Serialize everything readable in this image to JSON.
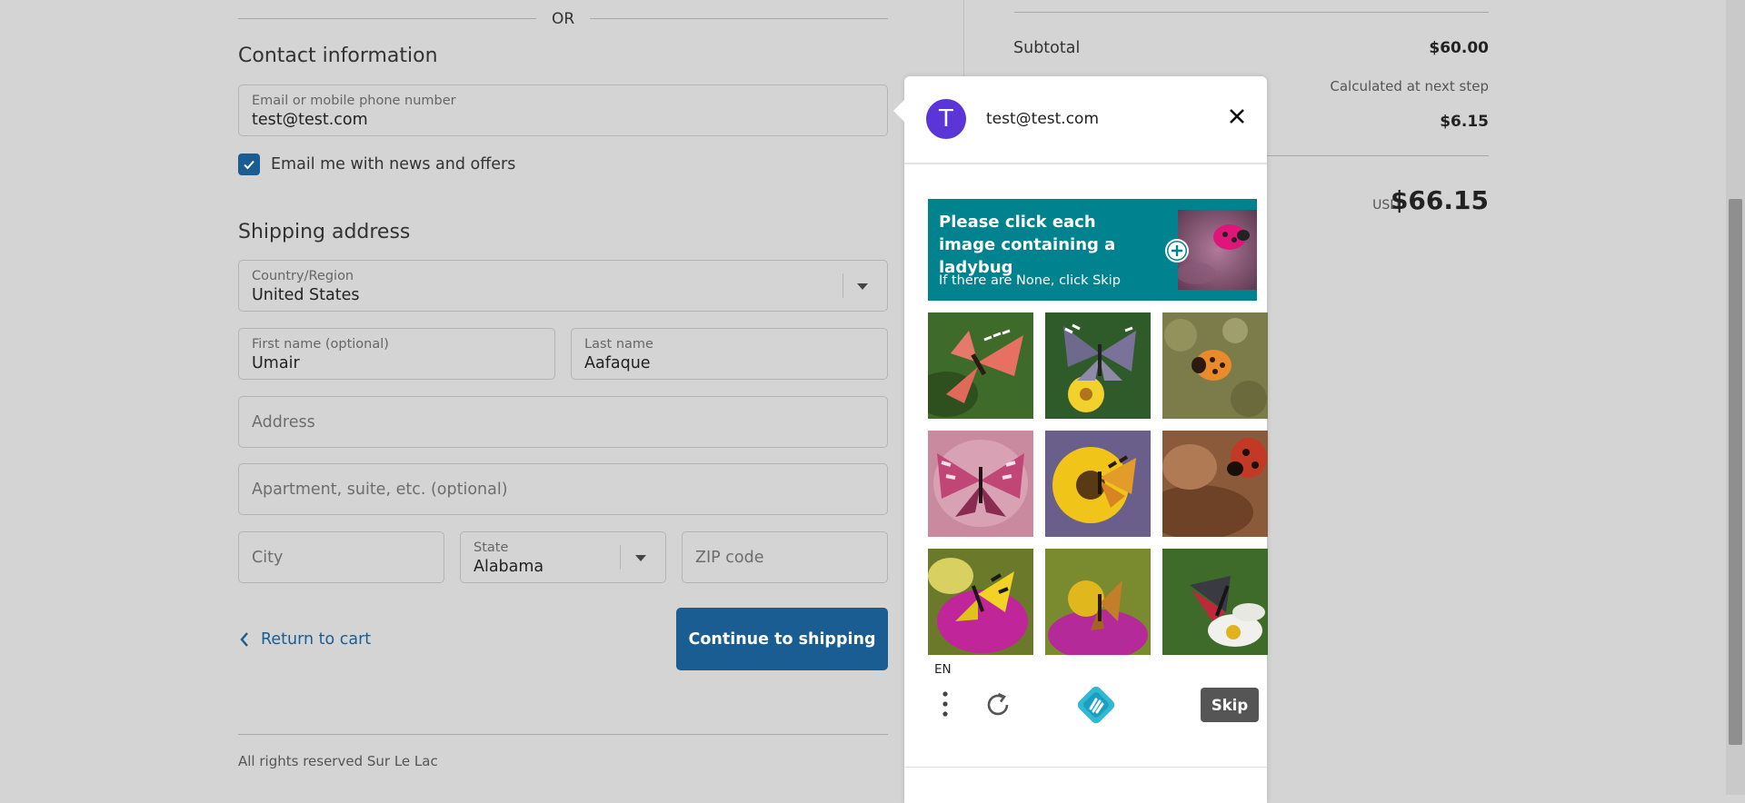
{
  "divider": {
    "or_text": "OR"
  },
  "contact": {
    "title": "Contact information",
    "email_label": "Email or mobile phone number",
    "email_value": "test@test.com",
    "newsletter_label": "Email me with news and offers",
    "newsletter_checked": true
  },
  "shipping": {
    "title": "Shipping address",
    "country_label": "Country/Region",
    "country_value": "United States",
    "first_name_label": "First name (optional)",
    "first_name_value": "Umair",
    "last_name_label": "Last name",
    "last_name_value": "Aafaque",
    "address_placeholder": "Address",
    "apartment_placeholder": "Apartment, suite, etc. (optional)",
    "city_placeholder": "City",
    "state_label": "State",
    "state_value": "Alabama",
    "zip_placeholder": "ZIP code"
  },
  "actions": {
    "return_label": "Return to cart",
    "continue_label": "Continue to shipping"
  },
  "footer": {
    "text": "All rights reserved Sur Le Lac"
  },
  "summary": {
    "subtotal_label": "Subtotal",
    "subtotal_value": "$60.00",
    "shipping_value": "Calculated at next step",
    "taxes_value": "$6.15",
    "total_currency": "USD",
    "total_value": "$66.15"
  },
  "captcha": {
    "avatar_letter": "T",
    "email": "test@test.com",
    "prompt": "Please click each image containing a ladybug",
    "subprompt": "If there are None, click Skip",
    "lang": "EN",
    "skip_label": "Skip",
    "tiles": [
      "butterfly",
      "butterfly",
      "ladybug",
      "butterfly",
      "butterfly",
      "ladybug",
      "butterfly",
      "butterfly",
      "butterfly"
    ]
  },
  "colors": {
    "accent": "#1a5d92",
    "avatar": "#5b35d6",
    "prompt_bg": "#00838f",
    "page_bg": "#d4d4d4"
  }
}
